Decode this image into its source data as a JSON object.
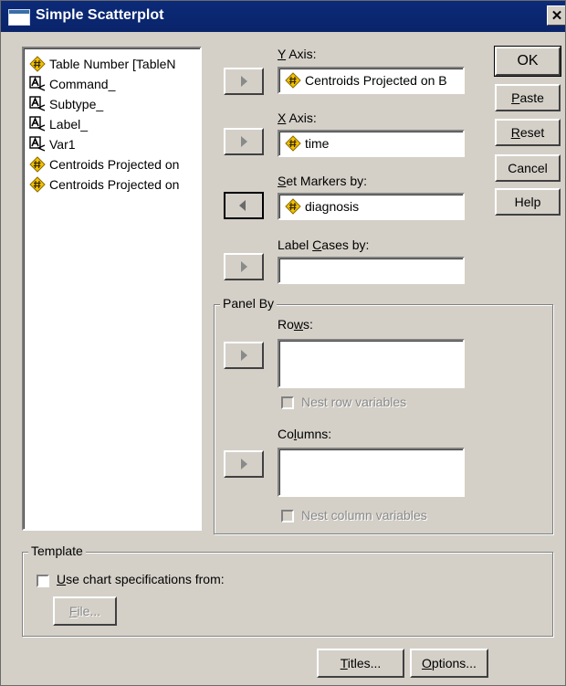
{
  "window": {
    "title": "Simple Scatterplot",
    "close_glyph": "✕"
  },
  "variables": [
    {
      "label": "Table Number [TableN",
      "icon": "scale-icon"
    },
    {
      "label": "Command_",
      "icon": "nominal-icon"
    },
    {
      "label": "Subtype_",
      "icon": "nominal-icon"
    },
    {
      "label": "Label_",
      "icon": "nominal-icon"
    },
    {
      "label": "Var1",
      "icon": "nominal-icon"
    },
    {
      "label": "Centroids Projected on",
      "icon": "scale-icon"
    },
    {
      "label": "Centroids Projected on",
      "icon": "scale-icon"
    }
  ],
  "y_axis": {
    "label_pre": "",
    "label_ul": "Y",
    "label_post": " Axis:",
    "value": "Centroids Projected on B"
  },
  "x_axis": {
    "label_pre": "",
    "label_ul": "X",
    "label_post": " Axis:",
    "value": "time"
  },
  "markers": {
    "label_pre": "",
    "label_ul": "S",
    "label_post": "et Markers by:",
    "value": "diagnosis"
  },
  "label_cases": {
    "label_pre": "Label ",
    "label_ul": "C",
    "label_post": "ases by:",
    "value": ""
  },
  "panel_by": {
    "title": "Panel By",
    "rows": {
      "label_pre": "Ro",
      "label_ul": "w",
      "label_post": "s:",
      "nest": "Nest row variables"
    },
    "columns": {
      "label_pre": "Co",
      "label_ul": "l",
      "label_post": "umns:",
      "nest": "Nest column variables"
    }
  },
  "buttons": {
    "ok": "OK",
    "paste": {
      "ul": "P",
      "rest": "aste"
    },
    "reset": {
      "ul": "R",
      "rest": "eset"
    },
    "cancel": "Cancel",
    "help": "Help",
    "titles": {
      "ul": "T",
      "rest": "itles..."
    },
    "options": {
      "ul": "O",
      "rest": "ptions..."
    }
  },
  "template": {
    "title": "Template",
    "use_spec": {
      "ul": "U",
      "rest": "se chart specifications from:"
    },
    "file": {
      "ul": "F",
      "rest": "ile..."
    }
  }
}
